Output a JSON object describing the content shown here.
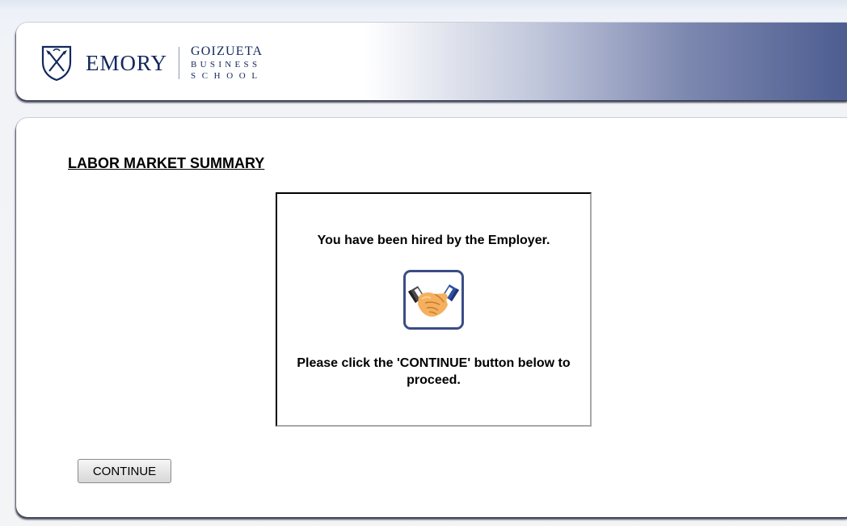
{
  "header": {
    "logo": {
      "primary": "EMORY",
      "secondary_line1": "GOIZUETA",
      "secondary_line2": "BUSINESS",
      "secondary_line3": "SCHOOL",
      "icon": "emory-shield-icon"
    },
    "gradient_colors": [
      "#ffffff",
      "#4a5a8e"
    ]
  },
  "main": {
    "title": "LABOR MARKET SUMMARY",
    "message_box": {
      "hired_text": "You have been hired by the Employer.",
      "icon": "handshake-icon",
      "instruction_text": "Please click the 'CONTINUE' button below to proceed."
    },
    "continue_label": "CONTINUE"
  },
  "colors": {
    "brand_navy": "#12285c",
    "icon_frame": "#3b4d86"
  }
}
